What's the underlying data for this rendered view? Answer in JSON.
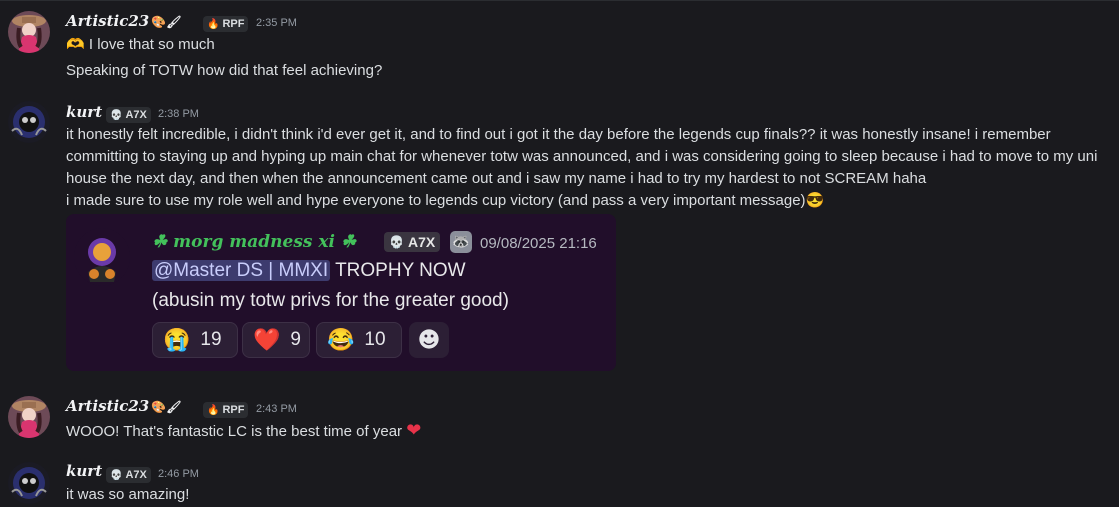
{
  "messages": [
    {
      "user": "Artistic23",
      "user_deco": "🎨🖌",
      "tag_icon": "flame-icon",
      "tag": "RPF",
      "time": "2:35 PM",
      "lines": [
        "I love that so much",
        "Speaking of TOTW how did that feel achieving?"
      ],
      "line1_emoji": "🫶"
    },
    {
      "user": "kurt",
      "tag_icon": "skull-icon",
      "tag": "A7X",
      "time": "2:38 PM",
      "lines": [
        "it honestly felt incredible, i didn't think i'd ever get it, and to find out i got it the day before the legends cup finals?? it was honestly insane! i remember",
        "committing to staying up and hyping up main chat for whenever totw was announced, and i was considering going to sleep because i had to move to my uni",
        "house the next day, and then when the announcement came out and i saw my name i had to try my hardest to not SCREAM haha",
        "i made sure to use my role well and hype everyone to legends cup victory (and pass a very important message)"
      ],
      "last_emoji": "😎",
      "embed": {
        "name": "☘ morg madness xi ☘",
        "tag_icon": "skull-icon",
        "tag": "A7X",
        "badge_icon": "raccoon-icon",
        "time": "09/08/2025 21:16",
        "mention": "@Master DS | MMXI",
        "line1_rest": "TROPHY NOW",
        "line2": "(abusin my totw privs for the greater good)",
        "reactions": [
          {
            "icon": "😭",
            "count": "19"
          },
          {
            "icon": "❤️",
            "count": "9"
          },
          {
            "icon": "😂",
            "count": "10"
          }
        ],
        "add_reaction_icon": "☻"
      }
    },
    {
      "user": "Artistic23",
      "user_deco": "🎨🖌",
      "tag_icon": "flame-icon",
      "tag": "RPF",
      "time": "2:43 PM",
      "lines": [
        "WOOO! That's fantastic LC is the best time of year"
      ],
      "last_emoji": "❤"
    },
    {
      "user": "kurt",
      "tag_icon": "skull-icon",
      "tag": "A7X",
      "time": "2:46 PM",
      "lines": [
        "it was so amazing!"
      ]
    }
  ],
  "colors": {
    "background": "#1a1a1e",
    "text": "#dbdee1",
    "timestamp": "#949ba4",
    "embed_bg": "#210e2a",
    "embed_name": "#43c15b",
    "mention_bg": "#3d3b6e"
  }
}
